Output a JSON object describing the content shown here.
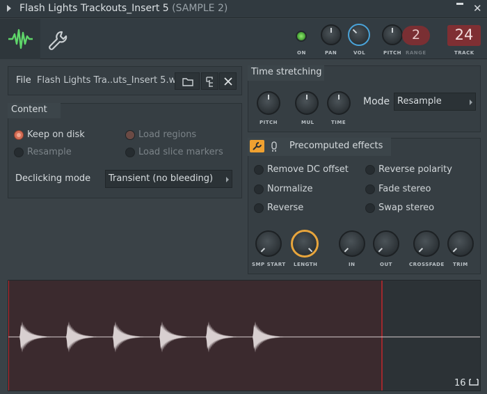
{
  "window": {
    "title": "Flash Lights Trackouts_Insert 5",
    "subtitle": "(SAMPLE 2)",
    "close_glyph": "✕"
  },
  "toolbar": {
    "on_label": "ON",
    "pan_label": "PAN",
    "vol_label": "VOL",
    "pitch_label": "PITCH",
    "range_label": "RANGE",
    "range_value": "2",
    "track_label": "TRACK",
    "track_value": "24",
    "led_color": "#6fd14f",
    "vol_accent": "#4aa3d8"
  },
  "file": {
    "label": "File",
    "name": "Flash Lights Tra..uts_Insert 5.wav",
    "icons": [
      "folder-icon",
      "file-browse-icon",
      "close-icon"
    ]
  },
  "content": {
    "title": "Content",
    "keep_on_disk": "Keep on disk",
    "resample": "Resample",
    "load_regions": "Load regions",
    "load_slice_markers": "Load slice markers",
    "declicking_label": "Declicking mode",
    "declicking_value": "Transient (no bleeding)"
  },
  "time_stretching": {
    "title": "Time stretching",
    "pitch_label": "PITCH",
    "mul_label": "MUL",
    "time_label": "TIME",
    "mode_label": "Mode",
    "mode_value": "Resample"
  },
  "precomputed": {
    "title": "Precomputed effects",
    "remove_dc": "Remove DC offset",
    "normalize": "Normalize",
    "reverse": "Reverse",
    "reverse_polarity": "Reverse polarity",
    "fade_stereo": "Fade stereo",
    "swap_stereo": "Swap stereo",
    "smp_start_label": "SMP START",
    "length_label": "LENGTH",
    "in_label": "IN",
    "out_label": "OUT",
    "crossfade_label": "CROSSFADE",
    "trim_label": "TRIM",
    "length_accent": "#e8a53c"
  },
  "waveform": {
    "zoom_value": "16",
    "region_color": "#3b2a2e",
    "marker_color": "#c1272d",
    "wave_color": "#d8cfd0",
    "hit_count": 6
  }
}
